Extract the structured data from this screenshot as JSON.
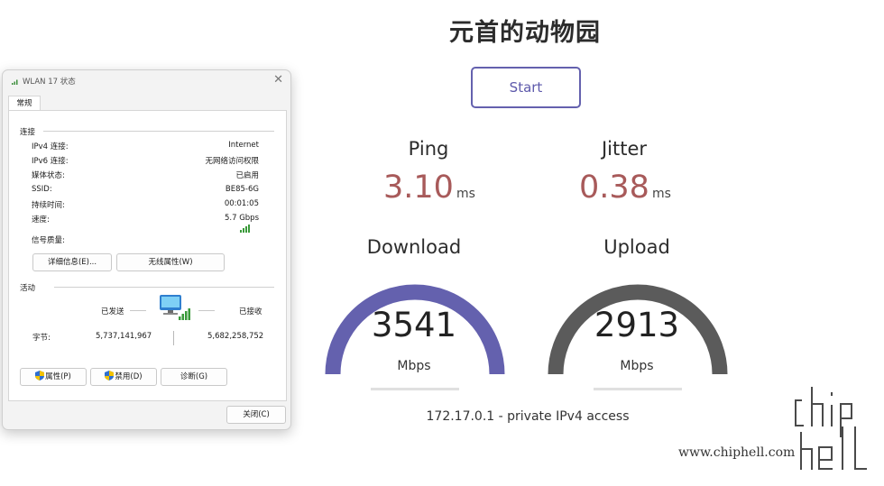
{
  "dialog": {
    "title": "WLAN 17 状态",
    "tab": "常规",
    "connection_section": "连接",
    "rows": [
      {
        "label": "IPv4 连接:",
        "value": "Internet"
      },
      {
        "label": "IPv6 连接:",
        "value": "无网络访问权限"
      },
      {
        "label": "媒体状态:",
        "value": "已启用"
      },
      {
        "label": "SSID:",
        "value": "BE85-6G"
      },
      {
        "label": "持续时间:",
        "value": "00:01:05"
      },
      {
        "label": "速度:",
        "value": "5.7 Gbps"
      }
    ],
    "signal_label": "信号质量:",
    "details_button": "详细信息(E)...",
    "wireless_props_button": "无线属性(W)",
    "activity_section": "活动",
    "sent_label": "已发送",
    "received_label": "已接收",
    "bytes_label": "字节:",
    "bytes_sent": "5,737,141,967",
    "bytes_received": "5,682,258,752",
    "properties_button": "属性(P)",
    "disable_button": "禁用(D)",
    "diagnose_button": "诊断(G)",
    "close_button": "关闭(C)"
  },
  "speedtest": {
    "title": "元首的动物园",
    "start_button": "Start",
    "ping_label": "Ping",
    "ping_value": "3.10",
    "ping_unit": "ms",
    "jitter_label": "Jitter",
    "jitter_value": "0.38",
    "jitter_unit": "ms",
    "download_label": "Download",
    "download_value": "3541",
    "download_unit": "Mbps",
    "upload_label": "Upload",
    "upload_value": "2913",
    "upload_unit": "Mbps",
    "ip_info": "172.17.0.1 - private IPv4 access",
    "colors": {
      "download_arc": "#6461ae",
      "upload_arc": "#5b5b5b",
      "metric_value": "#a85a5a"
    }
  },
  "watermark": {
    "site": "www.chiphell.com",
    "logo_text": "chip hell"
  }
}
